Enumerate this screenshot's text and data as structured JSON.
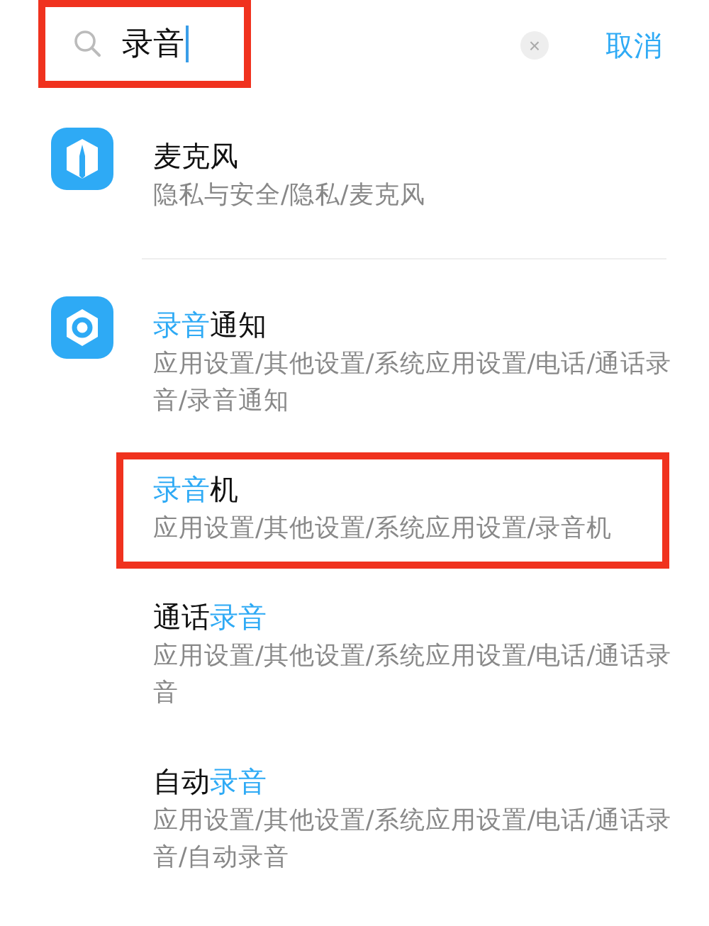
{
  "search": {
    "value": "录音",
    "marked": true
  },
  "clear_label": "×",
  "cancel": "取消",
  "groups": [
    {
      "kind": "privacy",
      "results": [
        {
          "title": [
            {
              "text": "麦克风",
              "highlight": false
            }
          ],
          "path": "隐私与安全/隐私/麦克风",
          "marked": false
        }
      ]
    },
    {
      "kind": "settings",
      "results": [
        {
          "title": [
            {
              "text": "录音",
              "highlight": true
            },
            {
              "text": "通知",
              "highlight": false
            }
          ],
          "path": "应用设置/其他设置/系统应用设置/电话/通话录音/录音通知",
          "marked": false
        },
        {
          "title": [
            {
              "text": "录音",
              "highlight": true
            },
            {
              "text": "机",
              "highlight": false
            }
          ],
          "path": "应用设置/其他设置/系统应用设置/录音机",
          "marked": true
        },
        {
          "title": [
            {
              "text": "通话",
              "highlight": false
            },
            {
              "text": "录音",
              "highlight": true
            }
          ],
          "path": "应用设置/其他设置/系统应用设置/电话/通话录音",
          "marked": false
        },
        {
          "title": [
            {
              "text": "自动",
              "highlight": false
            },
            {
              "text": "录音",
              "highlight": true
            }
          ],
          "path": "应用设置/其他设置/系统应用设置/电话/通话录音/自动录音",
          "marked": false
        }
      ]
    }
  ]
}
